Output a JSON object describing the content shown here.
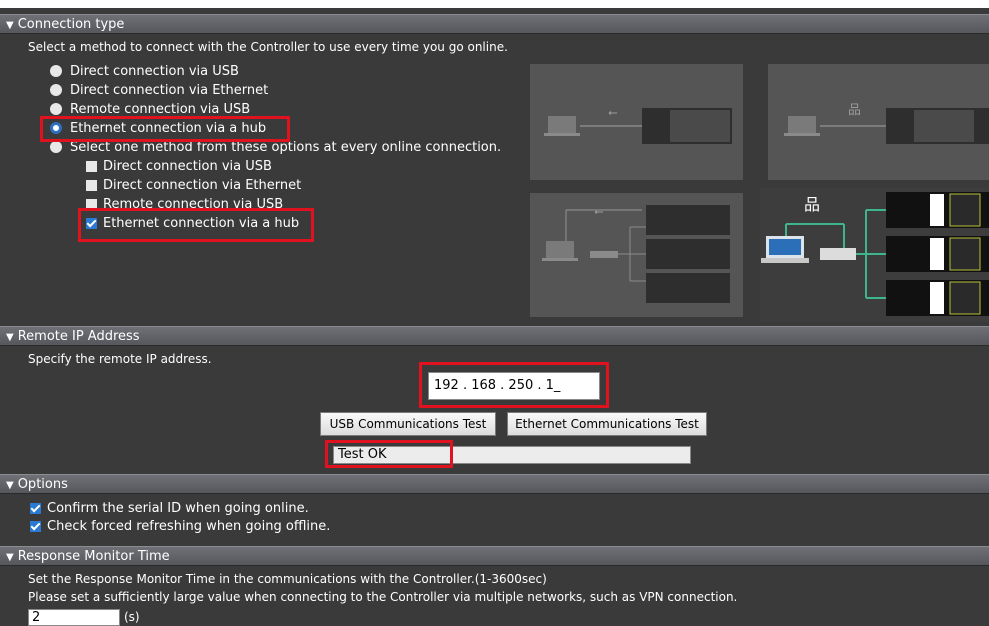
{
  "sections": {
    "connection_type": "Connection type",
    "remote_ip": "Remote IP Address",
    "options": "Options",
    "response_monitor": "Response Monitor Time"
  },
  "connection": {
    "intro": "Select a method to connect with the Controller to use every time you go online.",
    "radios": [
      {
        "label": "Direct connection via USB",
        "selected": false
      },
      {
        "label": "Direct connection via Ethernet",
        "selected": false
      },
      {
        "label": "Remote connection via USB",
        "selected": false
      },
      {
        "label": "Ethernet connection via a hub",
        "selected": true
      },
      {
        "label": "Select one method from these options at every online connection.",
        "selected": false
      }
    ],
    "checkboxes": [
      {
        "label": "Direct connection via USB",
        "checked": false
      },
      {
        "label": "Direct connection via Ethernet",
        "checked": false
      },
      {
        "label": "Remote connection via USB",
        "checked": false
      },
      {
        "label": "Ethernet connection via a hub",
        "checked": true
      }
    ]
  },
  "remote_ip": {
    "instruction": "Specify the remote IP address.",
    "ip_value": "192 . 168 . 250 . 1_",
    "usb_test_button": "USB Communications Test",
    "eth_test_button": "Ethernet Communications Test",
    "test_result": "Test OK"
  },
  "options": {
    "items": [
      {
        "label": "Confirm the serial ID when going online.",
        "checked": true
      },
      {
        "label": "Check forced refreshing when going offline.",
        "checked": true
      }
    ]
  },
  "response": {
    "line1": "Set the Response Monitor Time in the communications with the Controller.(1-3600sec)",
    "line2": "Please set a sufficiently large value when connecting to the Controller via multiple networks, such as VPN connection.",
    "value": "2",
    "unit": "(s)"
  },
  "icons": [
    "usb-icon",
    "network-icon",
    "laptop-icon",
    "hub-icon",
    "controller-icon"
  ],
  "colors": {
    "highlight": "#e0121f",
    "accent": "#2a7ad4",
    "link_line": "#3fb58b"
  }
}
